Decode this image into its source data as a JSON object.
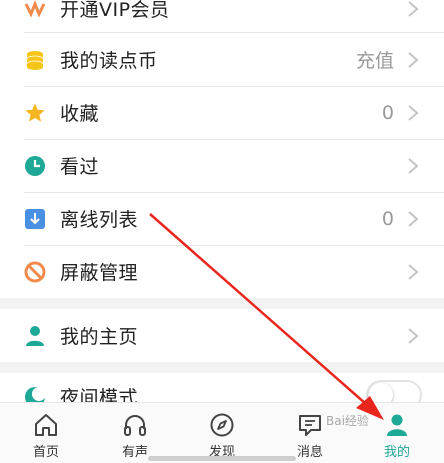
{
  "menu": {
    "items": [
      {
        "label": "开通VIP会员",
        "value": ""
      },
      {
        "label": "我的读点币",
        "value": "充值"
      },
      {
        "label": "收藏",
        "value": "0"
      },
      {
        "label": "看过",
        "value": ""
      },
      {
        "label": "离线列表",
        "value": "0"
      },
      {
        "label": "屏蔽管理",
        "value": ""
      },
      {
        "label": "我的主页",
        "value": ""
      },
      {
        "label": "夜间模式",
        "value": ""
      }
    ],
    "night_mode_on": false
  },
  "tabbar": {
    "tabs": [
      {
        "label": "首页",
        "icon": "home-icon"
      },
      {
        "label": "有声",
        "icon": "headphones-icon"
      },
      {
        "label": "发现",
        "icon": "compass-icon"
      },
      {
        "label": "消息",
        "icon": "message-icon"
      },
      {
        "label": "我的",
        "icon": "profile-icon"
      }
    ],
    "active": "我的"
  },
  "watermark": {
    "text": "Bai经验"
  },
  "colors": {
    "accent": "#1ea896",
    "coin": "#f5c518",
    "star": "#f5b622",
    "offline": "#4a90e2",
    "block": "#f08a4b",
    "arrow": "#e8261e"
  }
}
